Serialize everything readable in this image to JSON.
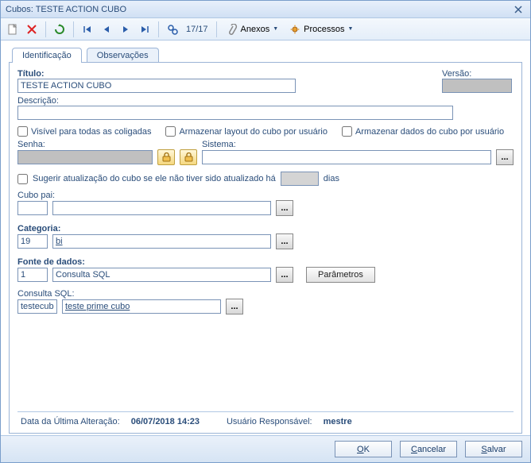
{
  "window": {
    "title": "Cubos: TESTE ACTION CUBO"
  },
  "toolbar": {
    "counter": "17/17",
    "anexos": "Anexos",
    "processos": "Processos"
  },
  "tabs": {
    "identificacao": "Identificação",
    "observacoes": "Observações"
  },
  "form": {
    "titulo_lbl": "Título:",
    "titulo_val": "TESTE ACTION CUBO",
    "versao_lbl": "Versão:",
    "versao_val": "",
    "descricao_lbl": "Descrição:",
    "descricao_val": "",
    "visivel_lbl": "Visível para todas as coligadas",
    "armazenar_layout_lbl": "Armazenar layout do cubo por usuário",
    "armazenar_dados_lbl": "Armazenar dados do cubo por usuário",
    "senha_lbl": "Senha:",
    "senha_val": "",
    "sistema_lbl": "Sistema:",
    "sistema_val": "",
    "sugerir_lbl": "Sugerir atualização do cubo se ele não tiver sido atualizado há",
    "sugerir_val": "",
    "dias_lbl": "dias",
    "cubopai_lbl": "Cubo pai:",
    "cubopai_code": "",
    "cubopai_name": "",
    "categoria_lbl": "Categoria:",
    "categoria_code": "19",
    "categoria_name": "bi",
    "fonte_lbl": "Fonte de dados:",
    "fonte_code": "1",
    "fonte_name": "Consulta SQL",
    "parametros_btn": "Parâmetros",
    "consulta_lbl": "Consulta SQL:",
    "consulta_code": "testecubo",
    "consulta_name": "teste prime cubo"
  },
  "footer": {
    "data_lbl": "Data da Última Alteração:",
    "data_val": "06/07/2018 14:23",
    "user_lbl": "Usuário Responsável:",
    "user_val": "mestre",
    "ok": "OK",
    "cancelar": "Cancelar",
    "salvar": "Salvar"
  }
}
